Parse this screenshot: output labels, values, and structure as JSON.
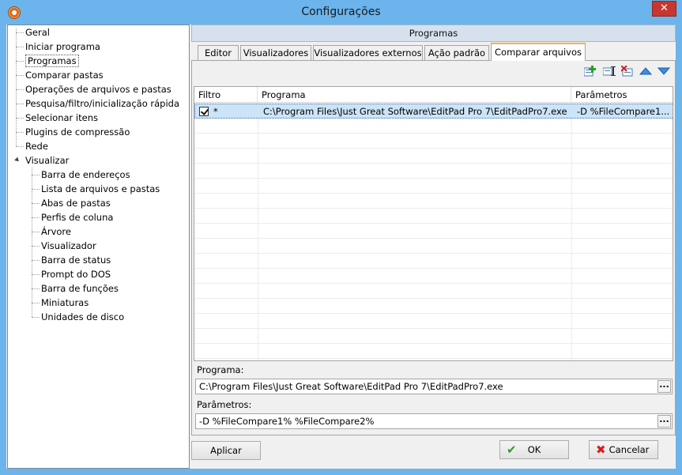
{
  "window": {
    "title": "Configurações",
    "close_glyph": "✕"
  },
  "tree": {
    "items": [
      {
        "label": "Geral",
        "name": "tree-item-geral"
      },
      {
        "label": "Iniciar programa",
        "name": "tree-item-iniciar-programa"
      },
      {
        "label": "Programas",
        "name": "tree-item-programas",
        "selected": true
      },
      {
        "label": "Comparar pastas",
        "name": "tree-item-comparar-pastas"
      },
      {
        "label": "Operações de arquivos e pastas",
        "name": "tree-item-operacoes"
      },
      {
        "label": "Pesquisa/filtro/inicialização rápida",
        "name": "tree-item-pesquisa"
      },
      {
        "label": "Selecionar itens",
        "name": "tree-item-selecionar-itens"
      },
      {
        "label": "Plugins de compressão",
        "name": "tree-item-plugins"
      },
      {
        "label": "Rede",
        "name": "tree-item-rede"
      },
      {
        "label": "Visualizar",
        "name": "tree-item-visualizar",
        "expanded": true
      }
    ],
    "children": [
      {
        "label": "Barra de endereços",
        "name": "tree-item-barra-enderecos"
      },
      {
        "label": "Lista de arquivos e pastas",
        "name": "tree-item-lista-arquivos"
      },
      {
        "label": "Abas de pastas",
        "name": "tree-item-abas-pastas"
      },
      {
        "label": "Perfis de coluna",
        "name": "tree-item-perfis-coluna"
      },
      {
        "label": "Árvore",
        "name": "tree-item-arvore"
      },
      {
        "label": "Visualizador",
        "name": "tree-item-visualizador"
      },
      {
        "label": "Barra de status",
        "name": "tree-item-barra-status"
      },
      {
        "label": "Prompt do DOS",
        "name": "tree-item-prompt-dos"
      },
      {
        "label": "Barra de funções",
        "name": "tree-item-barra-funcoes"
      },
      {
        "label": "Miniaturas",
        "name": "tree-item-miniaturas"
      },
      {
        "label": "Unidades de disco",
        "name": "tree-item-unidades-disco"
      }
    ]
  },
  "panel": {
    "header": "Programas",
    "tabs": [
      {
        "label": "Editor",
        "name": "tab-editor"
      },
      {
        "label": "Visualizadores",
        "name": "tab-visualizadores"
      },
      {
        "label": "Visualizadores externos",
        "name": "tab-visualizadores-externos"
      },
      {
        "label": "Ação padrão",
        "name": "tab-acao-padrao"
      },
      {
        "label": "Comparar arquivos",
        "name": "tab-comparar-arquivos",
        "active": true
      }
    ],
    "toolbar": [
      "add-icon",
      "edit-icon",
      "delete-icon",
      "move-up-icon",
      "move-down-icon"
    ],
    "colors": {
      "accent_tab": "#f2b24a",
      "selection": "#cce4f7",
      "header": "#d7e1ee"
    }
  },
  "grid": {
    "columns": [
      "Filtro",
      "Programa",
      "Parâmetros"
    ],
    "rows": [
      {
        "checked": true,
        "filter": "*",
        "program": "C:\\Program Files\\Just Great Software\\EditPad Pro 7\\EditPadPro7.exe",
        "params": "-D %FileCompare1..."
      }
    ]
  },
  "fields": {
    "program_label": "Programa:",
    "program_value": "C:\\Program Files\\Just Great Software\\EditPad Pro 7\\EditPadPro7.exe",
    "params_label": "Parâmetros:",
    "params_value": "-D %FileCompare1% %FileCompare2%",
    "browse_glyph": "..."
  },
  "buttons": {
    "apply": "Aplicar",
    "ok": "OK",
    "cancel": "Cancelar",
    "ok_glyph": "✔",
    "cancel_glyph": "✖"
  }
}
